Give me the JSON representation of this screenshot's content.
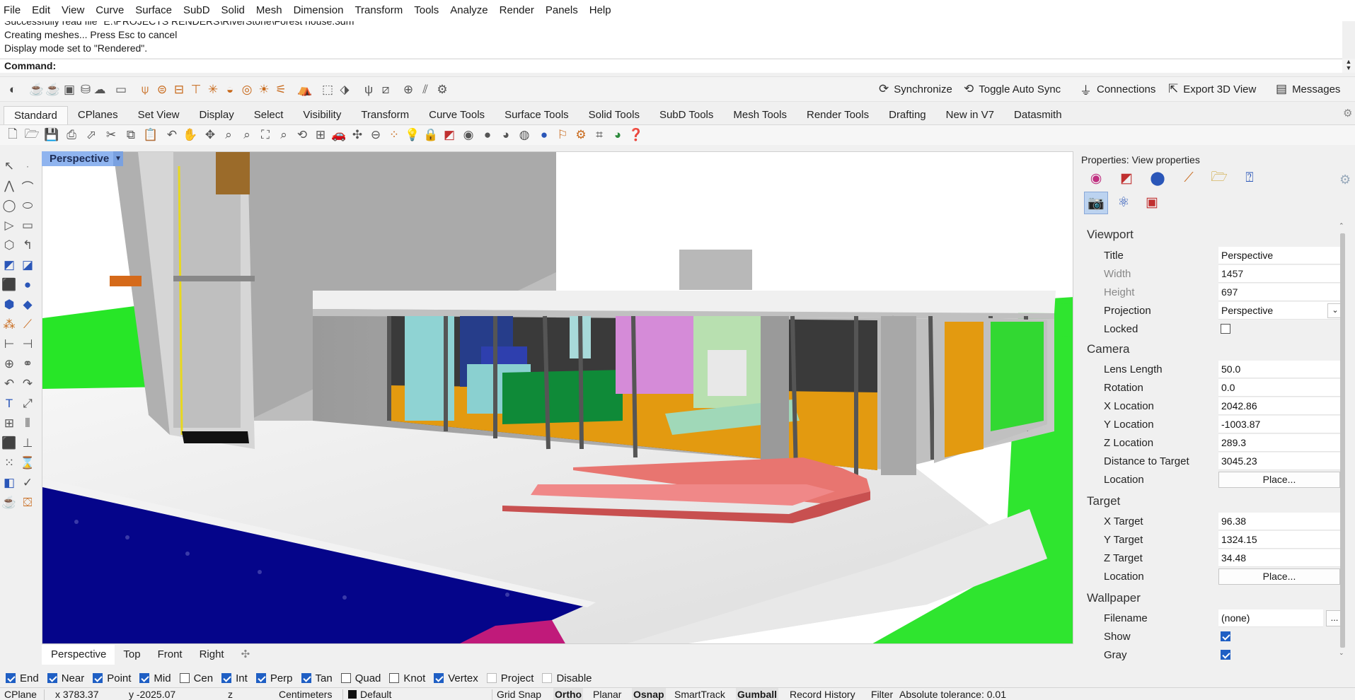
{
  "menu": [
    "File",
    "Edit",
    "View",
    "Curve",
    "Surface",
    "SubD",
    "Solid",
    "Mesh",
    "Dimension",
    "Transform",
    "Tools",
    "Analyze",
    "Render",
    "Panels",
    "Help"
  ],
  "history": {
    "line1": "Successfully read file \"E:\\PROJECTS RENDERS\\RiverStone\\Forest house.3dm\"",
    "line2": "Creating meshes... Press Esc to cancel",
    "line3": "Display mode set to \"Rendered\"."
  },
  "command": {
    "label": "Command:"
  },
  "sync": {
    "synchronize": "Synchronize",
    "toggle_auto_sync": "Toggle Auto Sync",
    "connections": "Connections",
    "export_3d_view": "Export 3D View",
    "messages": "Messages"
  },
  "tabs": [
    "Standard",
    "CPlanes",
    "Set View",
    "Display",
    "Select",
    "Visibility",
    "Transform",
    "Curve Tools",
    "Surface Tools",
    "Solid Tools",
    "SubD Tools",
    "Mesh Tools",
    "Render Tools",
    "Drafting",
    "New in V7",
    "Datasmith"
  ],
  "viewport": {
    "title": "Perspective"
  },
  "viewport_tabs": [
    "Perspective",
    "Top",
    "Front",
    "Right"
  ],
  "panel": {
    "title": "Properties: View properties",
    "viewport_section": "Viewport",
    "title_label": "Title",
    "title_value": "Perspective",
    "width_label": "Width",
    "width_value": "1457",
    "height_label": "Height",
    "height_value": "697",
    "projection_label": "Projection",
    "projection_value": "Perspective",
    "locked_label": "Locked",
    "locked": false,
    "camera_section": "Camera",
    "lens_label": "Lens Length",
    "lens_value": "50.0",
    "rotation_label": "Rotation",
    "rotation_value": "0.0",
    "xloc_label": "X Location",
    "xloc_value": "2042.86",
    "yloc_label": "Y Location",
    "yloc_value": "-1003.87",
    "zloc_label": "Z Location",
    "zloc_value": "289.3",
    "dist_label": "Distance to Target",
    "dist_value": "3045.23",
    "cam_location_label": "Location",
    "place_button": "Place...",
    "target_section": "Target",
    "xt_label": "X Target",
    "xt_value": "96.38",
    "yt_label": "Y Target",
    "yt_value": "1324.15",
    "zt_label": "Z Target",
    "zt_value": "34.48",
    "target_location_label": "Location",
    "wallpaper_section": "Wallpaper",
    "filename_label": "Filename",
    "filename_value": "(none)",
    "browse_button": "...",
    "show_label": "Show",
    "show": true,
    "gray_label": "Gray",
    "gray": true
  },
  "osnap": [
    {
      "label": "End",
      "checked": true
    },
    {
      "label": "Near",
      "checked": true
    },
    {
      "label": "Point",
      "checked": true
    },
    {
      "label": "Mid",
      "checked": true
    },
    {
      "label": "Cen",
      "checked": false
    },
    {
      "label": "Int",
      "checked": true
    },
    {
      "label": "Perp",
      "checked": true
    },
    {
      "label": "Tan",
      "checked": true
    },
    {
      "label": "Quad",
      "checked": false
    },
    {
      "label": "Knot",
      "checked": false
    },
    {
      "label": "Vertex",
      "checked": true
    },
    {
      "label": "Project",
      "checked": false
    },
    {
      "label": "Disable",
      "checked": false
    }
  ],
  "status": {
    "cplane": "CPlane",
    "x": "x 3783.37",
    "y": "y -2025.07",
    "z": "z",
    "units": "Centimeters",
    "layer": "Default",
    "grid_snap": "Grid Snap",
    "ortho": "Ortho",
    "planar": "Planar",
    "osnap": "Osnap",
    "smarttrack": "SmartTrack",
    "gumball": "Gumball",
    "record_history": "Record History",
    "filter": "Filter",
    "tolerance": "Absolute tolerance: 0.01"
  }
}
